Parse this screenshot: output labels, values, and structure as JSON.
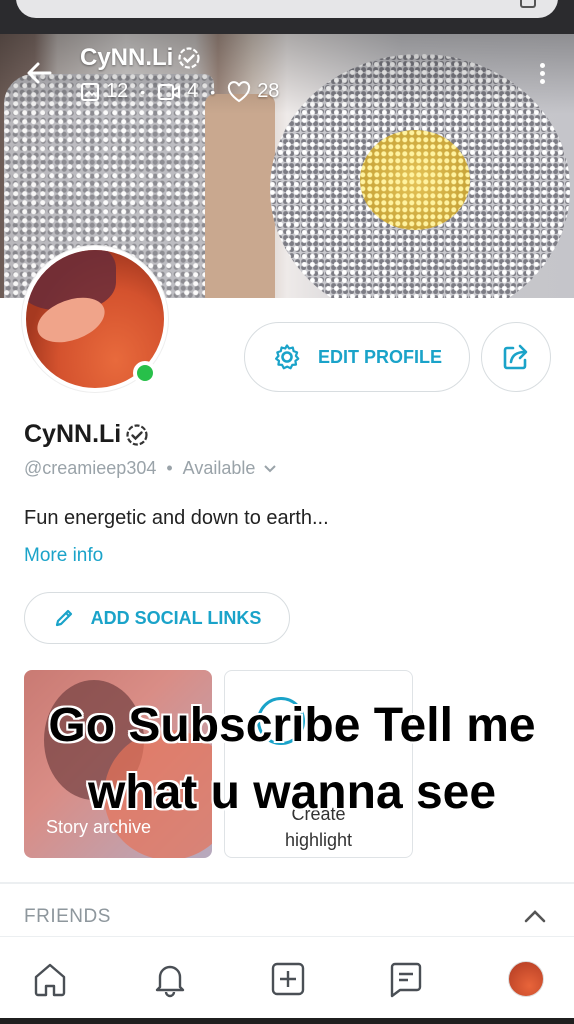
{
  "header": {
    "title": "CyNN.Li",
    "stats": {
      "photos": "12",
      "videos": "4",
      "likes": "28"
    }
  },
  "profile": {
    "name": "CyNN.Li",
    "handle": "@creamieep304",
    "status": "Available",
    "bio": "Fun energetic and down to earth...",
    "more_info": "More info",
    "online": true
  },
  "buttons": {
    "edit_profile": "EDIT PROFILE",
    "add_social_links": "ADD SOCIAL LINKS"
  },
  "tiles": {
    "story_archive": "Story archive",
    "highlight_line1": "Create",
    "highlight_line2": "highlight"
  },
  "overlay": {
    "text": "Go Subscribe Tell me what u wanna see"
  },
  "sections": {
    "friends": "FRIENDS"
  },
  "nav": {
    "items": [
      "home-icon",
      "bell-icon",
      "plus-square-icon",
      "messages-icon",
      "profile-avatar"
    ]
  },
  "colors": {
    "accent": "#1aa3c9",
    "online": "#28c04a",
    "muted": "#9aa3a9"
  }
}
